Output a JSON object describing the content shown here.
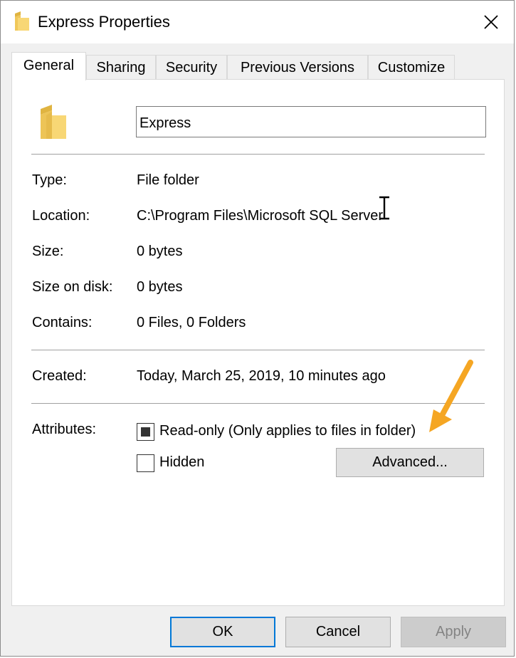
{
  "window": {
    "title": "Express Properties",
    "close_icon": "close-icon",
    "folder_icon": "folder-icon"
  },
  "tabs": [
    {
      "label": "General",
      "active": true
    },
    {
      "label": "Sharing",
      "active": false
    },
    {
      "label": "Security",
      "active": false
    },
    {
      "label": "Previous Versions",
      "active": false
    },
    {
      "label": "Customize",
      "active": false
    }
  ],
  "general": {
    "name_value": "Express",
    "fields": [
      {
        "label": "Type:",
        "value": "File folder"
      },
      {
        "label": "Location:",
        "value": "C:\\Program Files\\Microsoft SQL Server"
      },
      {
        "label": "Size:",
        "value": "0 bytes"
      },
      {
        "label": "Size on disk:",
        "value": "0 bytes"
      },
      {
        "label": "Contains:",
        "value": "0 Files, 0 Folders"
      }
    ],
    "created_label": "Created:",
    "created_value": "Today, March 25, 2019, 10 minutes ago",
    "attributes_label": "Attributes:",
    "readonly_label": "Read-only (Only applies to files in folder)",
    "readonly_state": "indeterminate",
    "hidden_label": "Hidden",
    "hidden_checked": false,
    "advanced_label": "Advanced..."
  },
  "footer": {
    "ok_label": "OK",
    "cancel_label": "Cancel",
    "apply_label": "Apply",
    "apply_enabled": false
  },
  "colors": {
    "accent": "#0078d7",
    "arrow": "#f5a623",
    "folder": "#f8d775"
  }
}
